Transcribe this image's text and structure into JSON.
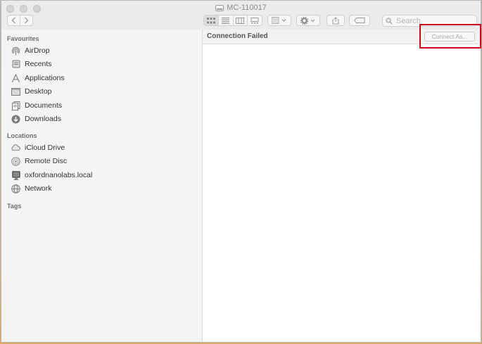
{
  "window": {
    "title": "MC-110017"
  },
  "toolbar": {
    "back_icon": "chevron-left-icon",
    "forward_icon": "chevron-right-icon",
    "view_modes": [
      "icon-view",
      "list-view",
      "column-view",
      "gallery-view"
    ],
    "active_view": "icon-view",
    "search": {
      "placeholder": "Search",
      "value": ""
    }
  },
  "sidebar": {
    "favourites_header": "Favourites",
    "favourites": [
      {
        "label": "AirDrop",
        "icon": "airdrop-icon"
      },
      {
        "label": "Recents",
        "icon": "recents-icon"
      },
      {
        "label": "Applications",
        "icon": "applications-icon"
      },
      {
        "label": "Desktop",
        "icon": "desktop-icon"
      },
      {
        "label": "Documents",
        "icon": "documents-icon"
      },
      {
        "label": "Downloads",
        "icon": "downloads-icon"
      }
    ],
    "locations_header": "Locations",
    "locations": [
      {
        "label": "iCloud Drive",
        "icon": "icloud-icon"
      },
      {
        "label": "Remote Disc",
        "icon": "disc-icon"
      },
      {
        "label": "oxfordnanolabs.local",
        "icon": "computer-icon"
      },
      {
        "label": "Network",
        "icon": "network-icon"
      }
    ],
    "tags_header": "Tags"
  },
  "main": {
    "status": "Connection Failed",
    "connect_label": "Connect As..."
  },
  "colors": {
    "highlight": "#d0021b",
    "sidebar_bg": "#f4f4f4",
    "toolbar_bg": "#ebebeb"
  }
}
